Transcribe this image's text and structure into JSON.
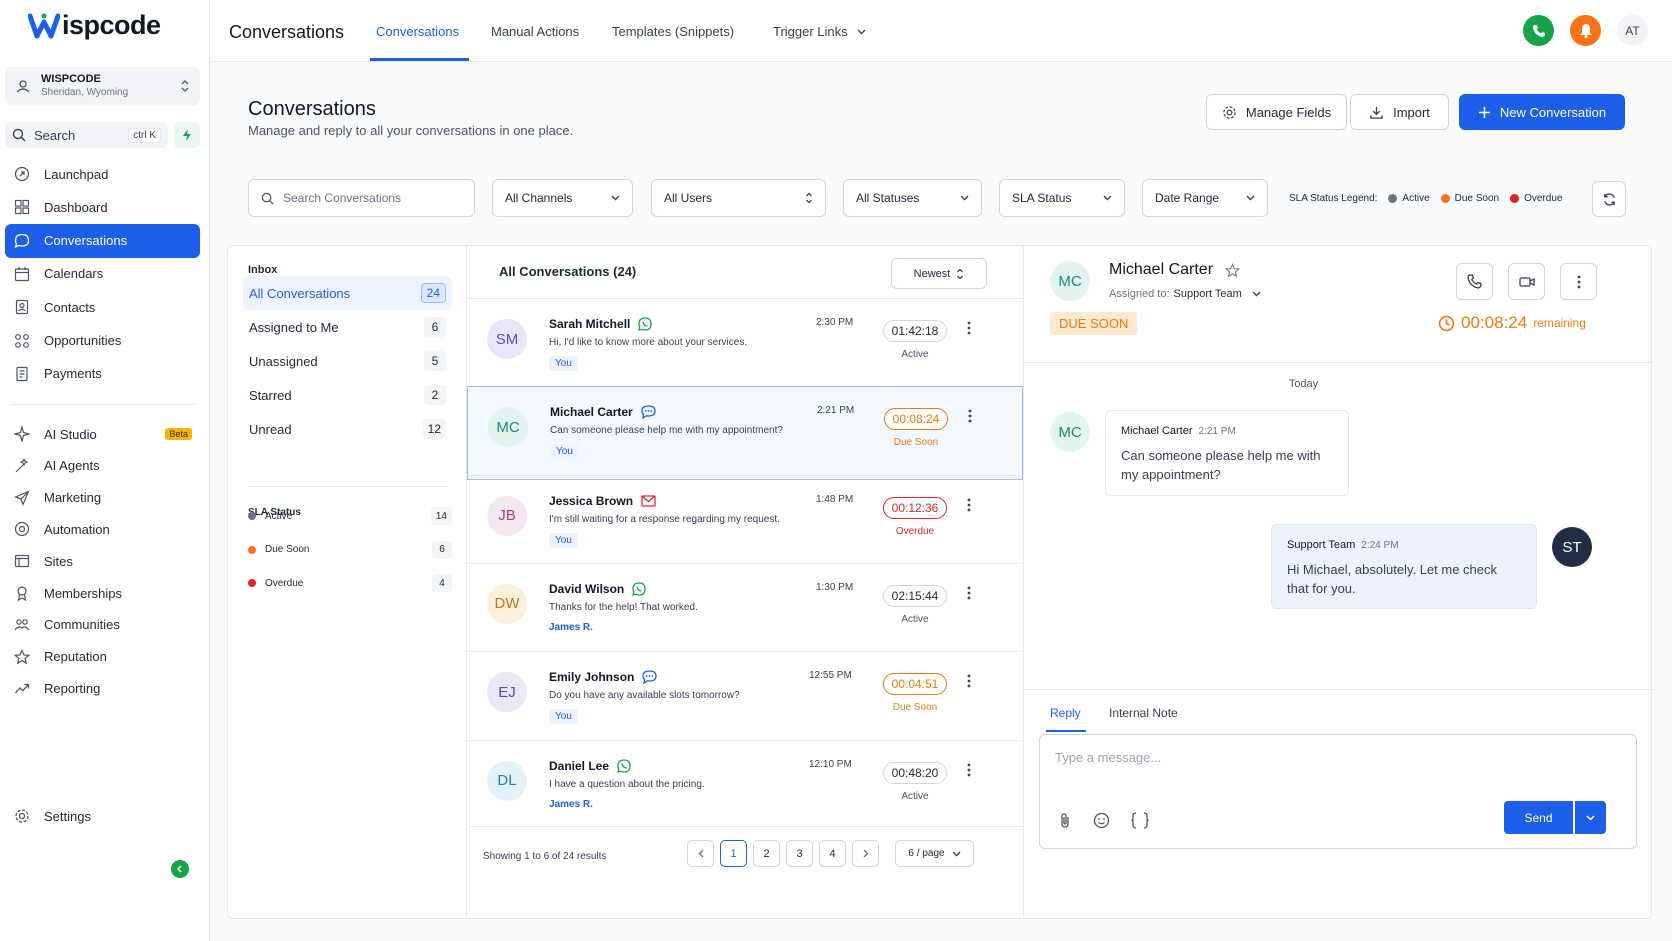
{
  "brand": {
    "logo_text": "ispcode"
  },
  "location": {
    "name": "WISPCODE",
    "place": "Sheridan, Wyoming"
  },
  "search": {
    "label": "Search",
    "shortcut": "ctrl K"
  },
  "nav": [
    {
      "label": "Launchpad",
      "icon": "launchpad-icon"
    },
    {
      "label": "Dashboard",
      "icon": "dashboard-icon"
    },
    {
      "label": "Conversations",
      "icon": "chat-icon",
      "active": true
    },
    {
      "label": "Calendars",
      "icon": "calendar-icon"
    },
    {
      "label": "Contacts",
      "icon": "contacts-icon"
    },
    {
      "label": "Opportunities",
      "icon": "opportunities-icon"
    },
    {
      "label": "Payments",
      "icon": "payments-icon"
    }
  ],
  "nav2": [
    {
      "label": "AI Studio",
      "icon": "ai-studio-icon",
      "badge": "Beta"
    },
    {
      "label": "AI Agents",
      "icon": "ai-agents-icon"
    },
    {
      "label": "Marketing",
      "icon": "send-icon"
    },
    {
      "label": "Automation",
      "icon": "automation-icon"
    },
    {
      "label": "Sites",
      "icon": "sites-icon"
    },
    {
      "label": "Memberships",
      "icon": "memberships-icon"
    },
    {
      "label": "Communities",
      "icon": "communities-icon"
    },
    {
      "label": "Reputation",
      "icon": "star-icon"
    },
    {
      "label": "Reporting",
      "icon": "reporting-icon"
    }
  ],
  "settings": {
    "label": "Settings"
  },
  "topbar": {
    "title": "Conversations",
    "tabs": [
      "Conversations",
      "Manual Actions",
      "Templates (Snippets)",
      "Trigger Links"
    ],
    "avatar_initials": "AT",
    "colors": {
      "phone": "#16a34a",
      "bell": "#f97316",
      "primary": "#1d5fe8"
    }
  },
  "page": {
    "title": "Conversations",
    "subtitle": "Manage and reply to all your conversations in one place.",
    "buttons": {
      "manage_fields": "Manage Fields",
      "import": "Import",
      "new_conversation": "New Conversation"
    }
  },
  "filters": {
    "search_placeholder": "Search Conversations",
    "channels": "All Channels",
    "users": "All Users",
    "statuses": "All Statuses",
    "sla": "SLA Status",
    "date": "Date Range",
    "legend_label": "SLA Status Legend:",
    "legend": [
      {
        "label": "Active",
        "color": "#6b7280"
      },
      {
        "label": "Due Soon",
        "color": "#f97316"
      },
      {
        "label": "Overdue",
        "color": "#dc2626"
      }
    ]
  },
  "inbox": {
    "title": "Inbox",
    "items": [
      {
        "label": "All Conversations",
        "count": "24",
        "active": true
      },
      {
        "label": "Assigned to Me",
        "count": "6"
      },
      {
        "label": "Unassigned",
        "count": "5"
      },
      {
        "label": "Starred",
        "count": "2"
      },
      {
        "label": "Unread",
        "count": "12"
      }
    ],
    "sla_title": "SLA Status",
    "sla_items": [
      {
        "label": "Active",
        "count": "14",
        "color": "#6b7280"
      },
      {
        "label": "Due Soon",
        "count": "6",
        "color": "#f97316"
      },
      {
        "label": "Overdue",
        "count": "4",
        "color": "#dc2626"
      }
    ]
  },
  "list": {
    "title": "All Conversations (24)",
    "sort": "Newest",
    "rows": [
      {
        "initials": "SM",
        "name": "Sarah Mitchell",
        "channel": "whatsapp-icon",
        "message": "Hi, I'd like to know more about your services.",
        "time": "2:30 PM",
        "timer": "01:42:18",
        "status": "Active",
        "tag": "You",
        "avatar_bg": "#e8e6fb",
        "avatar_fg": "#5b4bc4",
        "status_color": "#4b5563"
      },
      {
        "initials": "MC",
        "name": "Michael Carter",
        "channel": "chat-bubble-icon",
        "message": "Can someone please help me with my appointment?",
        "time": "2:21 PM",
        "timer": "00:08:24",
        "status": "Due Soon",
        "tag": "You",
        "avatar_bg": "#e2f4ef",
        "avatar_fg": "#1f8a70",
        "status_color": "#ea7a12",
        "selected": true
      },
      {
        "initials": "JB",
        "name": "Jessica Brown",
        "channel": "email-icon",
        "message": "I'm still waiting for a response regarding my request.",
        "time": "1:48 PM",
        "timer": "00:12:36",
        "status": "Overdue",
        "tag": "You",
        "avatar_bg": "#f6e6f1",
        "avatar_fg": "#a0417f",
        "status_color": "#dc2626"
      },
      {
        "initials": "DW",
        "name": "David Wilson",
        "channel": "whatsapp-icon",
        "message": "Thanks for the help! That worked.",
        "time": "1:30 PM",
        "timer": "02:15:44",
        "status": "Active",
        "by": "James R.",
        "avatar_bg": "#fdf0d8",
        "avatar_fg": "#b7791f",
        "status_color": "#4b5563"
      },
      {
        "initials": "EJ",
        "name": "Emily Johnson",
        "channel": "chat-bubble-icon",
        "message": "Do you have any available slots tomorrow?",
        "time": "12:55 PM",
        "timer": "00:04:51",
        "status": "Due Soon",
        "tag": "You",
        "avatar_bg": "#e8e8f8",
        "avatar_fg": "#4b4fb0",
        "status_color": "#ea7a12"
      },
      {
        "initials": "DL",
        "name": "Daniel Lee",
        "channel": "whatsapp-icon",
        "message": "I have a question about the pricing.",
        "time": "12:10 PM",
        "timer": "00:48:20",
        "status": "Active",
        "by": "James R.",
        "avatar_bg": "#e3f1f8",
        "avatar_fg": "#2a7ba6",
        "status_color": "#4b5563"
      }
    ],
    "footer": {
      "showing": "Showing 1 to 6 of 24 results",
      "pages": [
        "1",
        "2",
        "3",
        "4"
      ],
      "per_page": "6 / page"
    }
  },
  "detail": {
    "initials": "MC",
    "name": "Michael Carter",
    "assigned_label": "Assigned to:",
    "assigned_to": "Support Team",
    "due_badge": "DUE SOON",
    "timer": "00:08:24",
    "remaining": "remaining",
    "day": "Today",
    "messages": [
      {
        "author": "Michael Carter",
        "time": "2:21 PM",
        "text": "Can someone please help me with my appointment?"
      },
      {
        "author": "Support Team",
        "time": "2:24 PM",
        "text": "Hi Michael, absolutely. Let me check that for you.",
        "initials": "ST"
      }
    ],
    "tabs": [
      "Reply",
      "Internal Note"
    ],
    "compose_placeholder": "Type a message...",
    "send": "Send"
  }
}
